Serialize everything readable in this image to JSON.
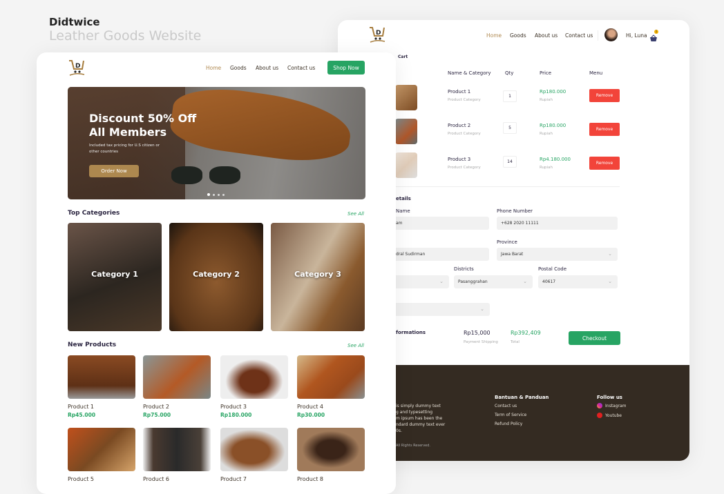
{
  "page": {
    "title": "Didtwice",
    "subtitle": "Leather Goods Website"
  },
  "cart_page": {
    "nav": [
      "Home",
      "Goods",
      "About us",
      "Contact us"
    ],
    "user_greeting": "Hi, Luna",
    "cart_badge": "1",
    "breadcrumb": "Cart",
    "columns": [
      "Name & Category",
      "Qty",
      "Price",
      "Menu"
    ],
    "items": [
      {
        "name": "Product 1",
        "category": "Product Category",
        "qty": "1",
        "price": "Rp180.000",
        "currency": "Rupiah",
        "action": "Remove"
      },
      {
        "name": "Product 2",
        "category": "Product Category",
        "qty": "5",
        "price": "Rp180.000",
        "currency": "Rupiah",
        "action": "Remove"
      },
      {
        "name": "Product 3",
        "category": "Product Category",
        "qty": "14",
        "price": "Rp4.180.000",
        "currency": "Rupiah",
        "action": "Remove"
      }
    ],
    "details_title": "etails",
    "form": {
      "name_label": "Name",
      "name_value": "am",
      "phone_label": "Phone Number",
      "phone_value": "+628 2020 11111",
      "address_value": "dral Sudirman",
      "province_label": "Province",
      "province_value": "Jawa Barat",
      "districts_label": "Districts",
      "districts_value": "Pasanggrahan",
      "postal_label": "Postal Code",
      "postal_value": "40617"
    },
    "summary": {
      "title": "formations",
      "shipping": "Rp15,000",
      "shipping_label": "Payment Shipping",
      "total": "Rp392,409",
      "total_label": "Total",
      "checkout": "Checkout"
    },
    "footer": {
      "about_lines": [
        "is simply dummy text",
        "g and typesetting",
        "m ipsum has been the",
        "ndard dummy text ever",
        "0s."
      ],
      "copyright": "All Rights Reserved.",
      "help_title": "Bantuan & Panduan",
      "help_links": [
        "Contact us",
        "Term of Service",
        "Refund Policy"
      ],
      "follow_title": "Follow us",
      "social": [
        "Instagram",
        "Youtube"
      ]
    }
  },
  "home_page": {
    "nav": [
      "Home",
      "Goods",
      "About us",
      "Contact us"
    ],
    "shop_now": "Shop Now",
    "hero": {
      "title_line1": "Discount 50% Off",
      "title_line2": "All Members",
      "text_line1": "Included tax pricing for U.S citizen or",
      "text_line2": "other countries",
      "cta": "Order Now",
      "slides": 4,
      "active_slide": 1
    },
    "categories_title": "Top Categories",
    "see_all": "See All",
    "categories": [
      "Category 1",
      "Category 2",
      "Category 3"
    ],
    "products_title": "New Products",
    "products": [
      {
        "name": "Product 1",
        "price": "Rp45.000"
      },
      {
        "name": "Product 2",
        "price": "Rp75.000"
      },
      {
        "name": "Product 3",
        "price": "Rp180.000"
      },
      {
        "name": "Product 4",
        "price": "Rp30.000"
      },
      {
        "name": "Product 5"
      },
      {
        "name": "Product 6"
      },
      {
        "name": "Product 7"
      },
      {
        "name": "Product 8"
      }
    ]
  },
  "colors": {
    "brand": "#b08a52",
    "accent_green": "#27a463",
    "danger": "#f2443a",
    "footer_bg": "#342b22"
  }
}
